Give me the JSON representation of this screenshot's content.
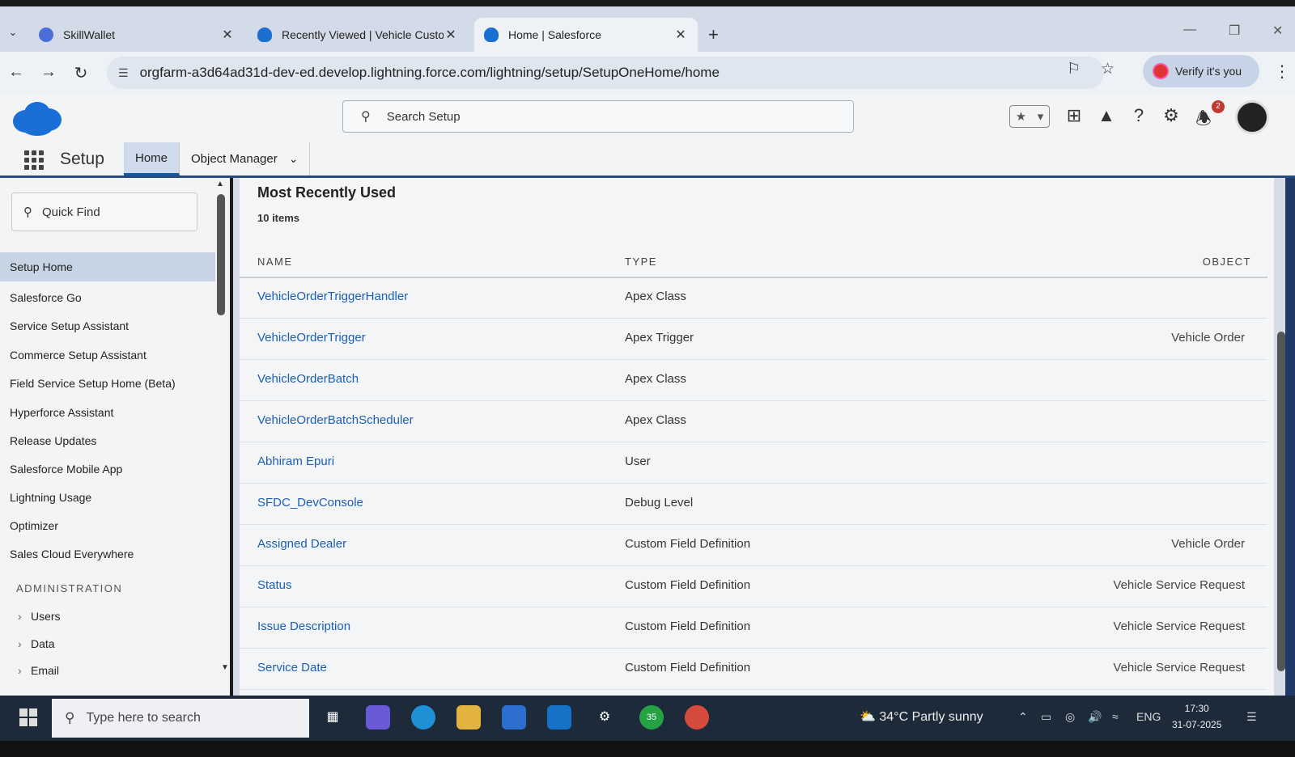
{
  "browser": {
    "tabs": [
      {
        "label": "SkillWallet",
        "active": false
      },
      {
        "label": "Recently Viewed | Vehicle Custo",
        "active": false
      },
      {
        "label": "Home | Salesforce",
        "active": true
      }
    ],
    "new_tab": "+",
    "url": "orgfarm-a3d64ad31d-dev-ed.develop.lightning.force.com/lightning/setup/SetupOneHome/home",
    "verify_label": "Verify it's you"
  },
  "header": {
    "search_placeholder": "Search Setup",
    "notification_count": "2"
  },
  "nav": {
    "app_title": "Setup",
    "tabs": [
      {
        "label": "Home"
      },
      {
        "label": "Object Manager"
      }
    ]
  },
  "sidebar": {
    "quick_find_placeholder": "Quick Find",
    "items": [
      {
        "label": "Setup Home"
      },
      {
        "label": "Salesforce Go"
      },
      {
        "label": "Service Setup Assistant"
      },
      {
        "label": "Commerce Setup Assistant"
      },
      {
        "label": "Field Service Setup Home (Beta)"
      },
      {
        "label": "Hyperforce Assistant"
      },
      {
        "label": "Release Updates"
      },
      {
        "label": "Salesforce Mobile App"
      },
      {
        "label": "Lightning Usage"
      },
      {
        "label": "Optimizer"
      },
      {
        "label": "Sales Cloud Everywhere"
      }
    ],
    "section_title": "ADMINISTRATION",
    "sub_items": [
      {
        "label": "Users"
      },
      {
        "label": "Data"
      },
      {
        "label": "Email"
      }
    ]
  },
  "main": {
    "title": "Most Recently Used",
    "count": "10 items",
    "columns": [
      "NAME",
      "TYPE",
      "OBJECT"
    ],
    "rows": [
      {
        "name": "VehicleOrderTriggerHandler",
        "type": "Apex Class",
        "object": ""
      },
      {
        "name": "VehicleOrderTrigger",
        "type": "Apex Trigger",
        "object": "Vehicle Order"
      },
      {
        "name": "VehicleOrderBatch",
        "type": "Apex Class",
        "object": ""
      },
      {
        "name": "VehicleOrderBatchScheduler",
        "type": "Apex Class",
        "object": ""
      },
      {
        "name": "Abhiram Epuri",
        "type": "User",
        "object": ""
      },
      {
        "name": "SFDC_DevConsole",
        "type": "Debug Level",
        "object": ""
      },
      {
        "name": "Assigned Dealer",
        "type": "Custom Field Definition",
        "object": "Vehicle Order"
      },
      {
        "name": "Status",
        "type": "Custom Field Definition",
        "object": "Vehicle Service Request"
      },
      {
        "name": "Issue Description",
        "type": "Custom Field Definition",
        "object": "Vehicle Service Request"
      },
      {
        "name": "Service Date",
        "type": "Custom Field Definition",
        "object": "Vehicle Service Request"
      }
    ]
  },
  "taskbar": {
    "search_placeholder": "Type here to search",
    "whatsapp_badge": "35",
    "weather": "34°C  Partly sunny",
    "language": "ENG",
    "time": "17:30",
    "date": "31-07-2025"
  },
  "colors": {
    "link": "#1a5fb4",
    "brand": "#0b5cab",
    "nav_accent": "#2a4a7c"
  }
}
